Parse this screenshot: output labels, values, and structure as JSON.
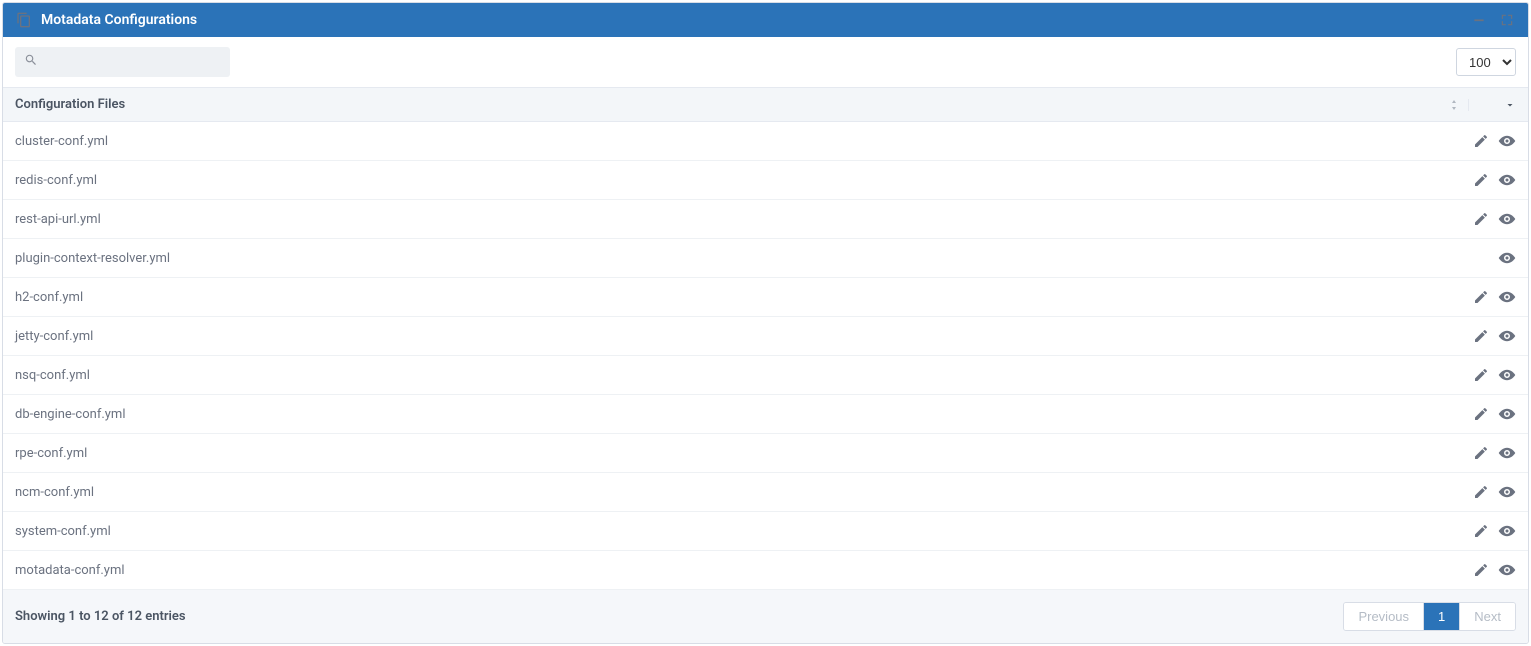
{
  "header": {
    "title": "Motadata Configurations"
  },
  "toolbar": {
    "search_placeholder": "",
    "page_size": "100"
  },
  "table": {
    "column_header": "Configuration Files",
    "rows": [
      {
        "name": "cluster-conf.yml",
        "editable": true
      },
      {
        "name": "redis-conf.yml",
        "editable": true
      },
      {
        "name": "rest-api-url.yml",
        "editable": true
      },
      {
        "name": "plugin-context-resolver.yml",
        "editable": false
      },
      {
        "name": "h2-conf.yml",
        "editable": true
      },
      {
        "name": "jetty-conf.yml",
        "editable": true
      },
      {
        "name": "nsq-conf.yml",
        "editable": true
      },
      {
        "name": "db-engine-conf.yml",
        "editable": true
      },
      {
        "name": "rpe-conf.yml",
        "editable": true
      },
      {
        "name": "ncm-conf.yml",
        "editable": true
      },
      {
        "name": "system-conf.yml",
        "editable": true
      },
      {
        "name": "motadata-conf.yml",
        "editable": true
      }
    ]
  },
  "footer": {
    "status": "Showing 1 to 12 of 12 entries",
    "prev": "Previous",
    "next": "Next",
    "current_page": "1"
  }
}
